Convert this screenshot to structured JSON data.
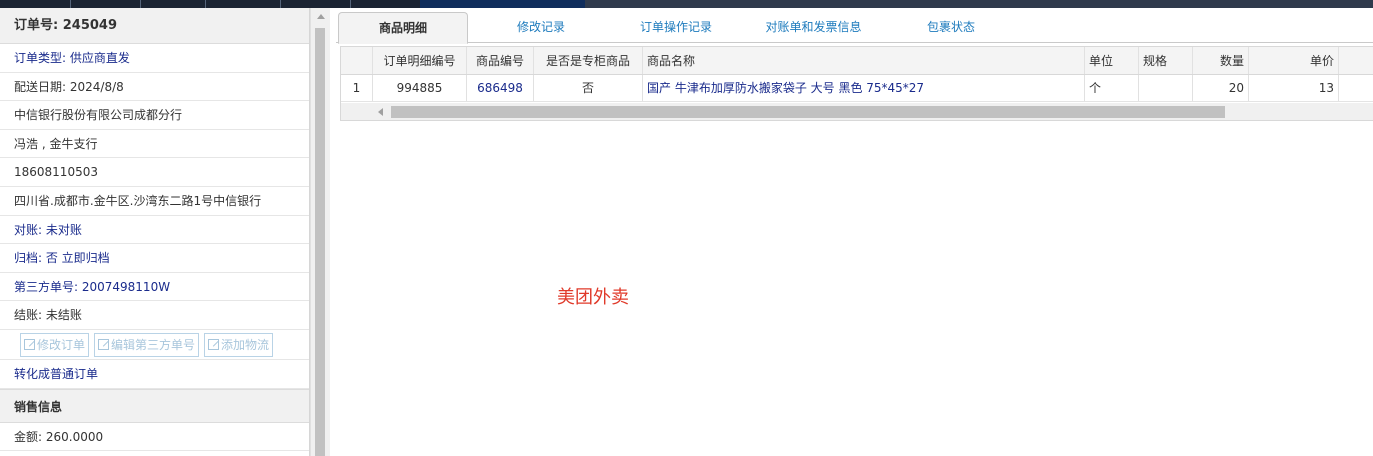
{
  "order": {
    "title": "订单号: 245049",
    "rows": [
      {
        "text": "订单类型: 供应商直发",
        "blue": true
      },
      {
        "text": "配送日期: 2024/8/8",
        "blue": false
      },
      {
        "text": "中信银行股份有限公司成都分行",
        "blue": false
      },
      {
        "text": "冯浩 , 金牛支行",
        "blue": false
      },
      {
        "text": "18608110503",
        "blue": false
      },
      {
        "text": "四川省.成都市.金牛区.沙湾东二路1号中信银行",
        "blue": false
      },
      {
        "text": "对账: 未对账",
        "blue": true
      },
      {
        "text": "归档:  否 立即归档",
        "blue": true
      },
      {
        "text": "第三方单号: 2007498110W",
        "blue": true
      },
      {
        "text": "结账: 未结账",
        "blue": false
      }
    ],
    "buttons": [
      "修改订单",
      "编辑第三方单号",
      "添加物流"
    ],
    "convert_link": "转化成普通订单",
    "sales_section": "销售信息",
    "amount": "金额: 260.0000"
  },
  "tabs": [
    "商品明细",
    "修改记录",
    "订单操作记录",
    "对账单和发票信息",
    "包裹状态"
  ],
  "table": {
    "headers": [
      "",
      "订单明细编号",
      "商品编号",
      "是否是专柜商品",
      "商品名称",
      "单位",
      "规格",
      "数量",
      "单价"
    ],
    "rows": [
      [
        "1",
        "994885",
        "686498",
        "否",
        "国产 牛津布加厚防水搬家袋子 大号 黑色 75*45*27",
        "个",
        "",
        "20",
        "13"
      ]
    ]
  },
  "overlay_text": "美团外卖",
  "colors": {
    "link": "#1a2b8c",
    "tab_text": "#1e7bbd",
    "overlay": "#e03a2a"
  }
}
